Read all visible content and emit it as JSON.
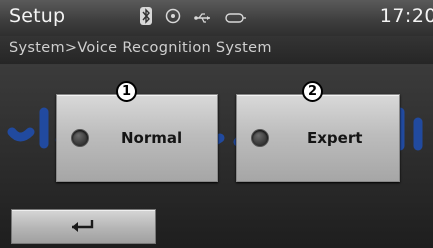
{
  "header": {
    "title": "Setup",
    "time": "17:20",
    "icons": [
      "bluetooth-icon",
      "disc-icon",
      "usb-icon",
      "aux-icon"
    ]
  },
  "breadcrumb": {
    "text": "System>Voice Recognition System"
  },
  "options": [
    {
      "label": "Normal",
      "marker": "1",
      "selected": false
    },
    {
      "label": "Expert",
      "marker": "2",
      "selected": false
    }
  ],
  "footer": {
    "back_icon": "return-arrow-icon"
  },
  "colors": {
    "watermark": "#1f4fb3",
    "button_face": "#c4c4c4",
    "status_bar": "#4a4a4a"
  }
}
